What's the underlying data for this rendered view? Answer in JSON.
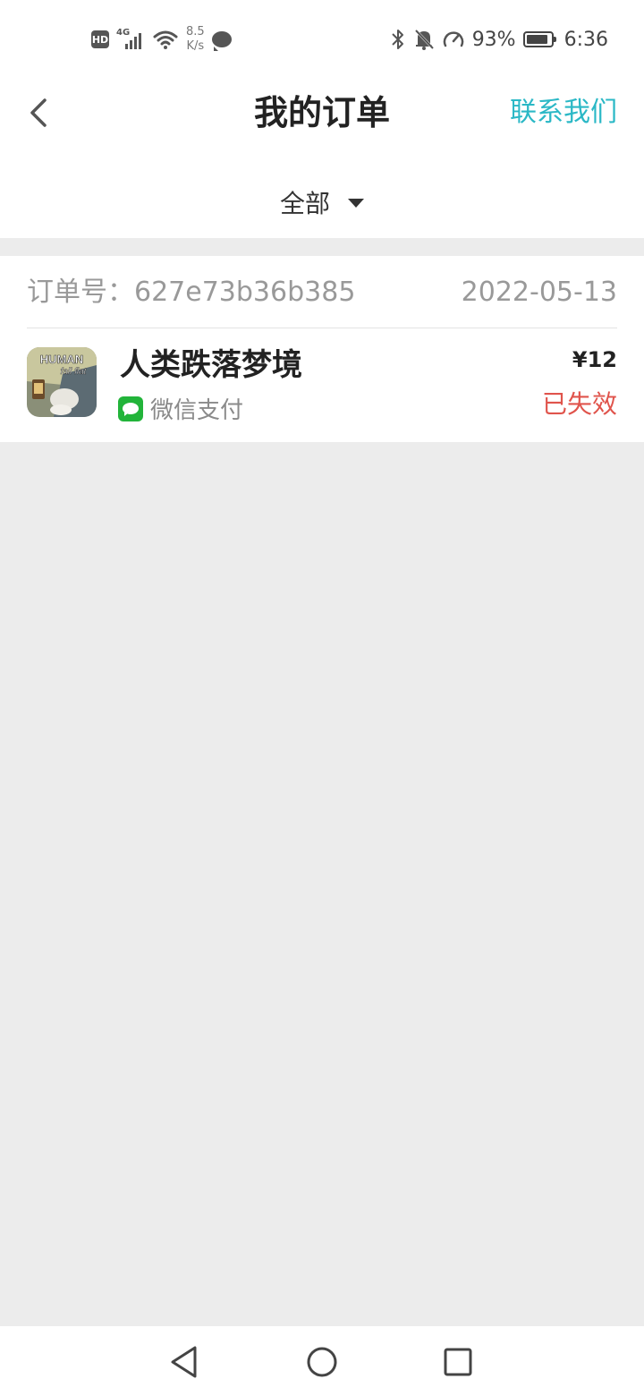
{
  "status_bar": {
    "hd_badge": "HD",
    "network_type": "4G",
    "speed_value": "8.5",
    "speed_unit": "K/s",
    "battery_percent": "93%",
    "battery_level": 0.93,
    "time": "6:36"
  },
  "header": {
    "title": "我的订单",
    "contact": "联系我们"
  },
  "filter": {
    "selected": "全部"
  },
  "orders": [
    {
      "order_no_label": "订单号：627e73b36b385",
      "date": "2022-05-13",
      "game_name": "人类跌落梦境",
      "icon_text_line1": "HUMAN",
      "icon_text_line2": "fall flat",
      "payment_method": "微信支付",
      "price": "¥12",
      "status": "已失效"
    }
  ],
  "colors": {
    "accent": "#2bb8c6",
    "expired": "#e0544c",
    "wechat": "#22b43a",
    "background": "#ececec"
  }
}
